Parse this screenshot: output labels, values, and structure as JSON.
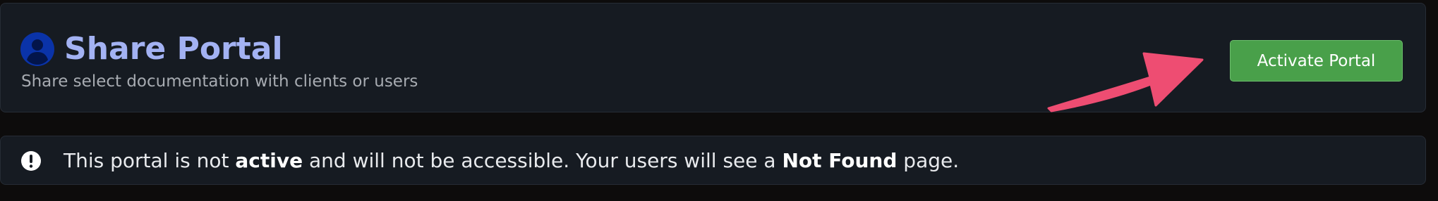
{
  "header": {
    "icon": "user-avatar-icon",
    "title": "Share Portal",
    "subtitle": "Share select documentation with clients or users",
    "activate_button_label": "Activate Portal",
    "annotation": "arrow-pointing-to-button"
  },
  "alert": {
    "icon": "exclamation-circle-icon",
    "text_part_1": "This portal is not ",
    "text_bold_1": "active",
    "text_part_2": " and will not be accessible. Your users will see a ",
    "text_bold_2": "Not Found",
    "text_part_3": " page."
  },
  "colors": {
    "page_background": "#0d0c0c",
    "card_background": "#161b22",
    "title": "#a3b2f3",
    "avatar": "#0a33a8",
    "button": "#49a04a",
    "arrow": "#ee4d72"
  }
}
